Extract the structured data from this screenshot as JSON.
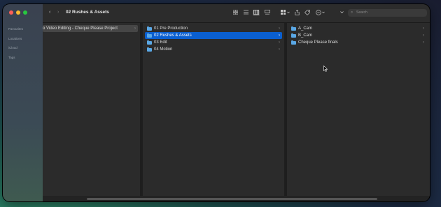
{
  "sidebar": {
    "items": [
      "Favourites",
      "Locations",
      "iCloud",
      "Tags"
    ]
  },
  "toolbar": {
    "back": "‹",
    "forward": "›",
    "title": "02 Rushes & Assets",
    "icons": [
      "grid-view-icon",
      "list-view-icon",
      "column-view-icon",
      "gallery-view-icon",
      "group-icon",
      "share-icon",
      "tag-icon",
      "more-actions-icon",
      "expand-chevron-icon"
    ],
    "search_placeholder": "Search"
  },
  "columns": {
    "col1": [
      {
        "label": "o Video Editing - Cheque Please Project",
        "selected": "gray"
      }
    ],
    "col2": [
      {
        "label": "01 Pre Production"
      },
      {
        "label": "02 Rushes & Assets",
        "selected": "blue"
      },
      {
        "label": "03 Edit"
      },
      {
        "label": "04 Motion"
      }
    ],
    "col3": [
      {
        "label": "A_Cam"
      },
      {
        "label": "B_Cam"
      },
      {
        "label": "Cheque Please finals"
      }
    ]
  },
  "glyphs": {
    "chevron": "›",
    "search": "⌕",
    "cursor": "➤"
  }
}
